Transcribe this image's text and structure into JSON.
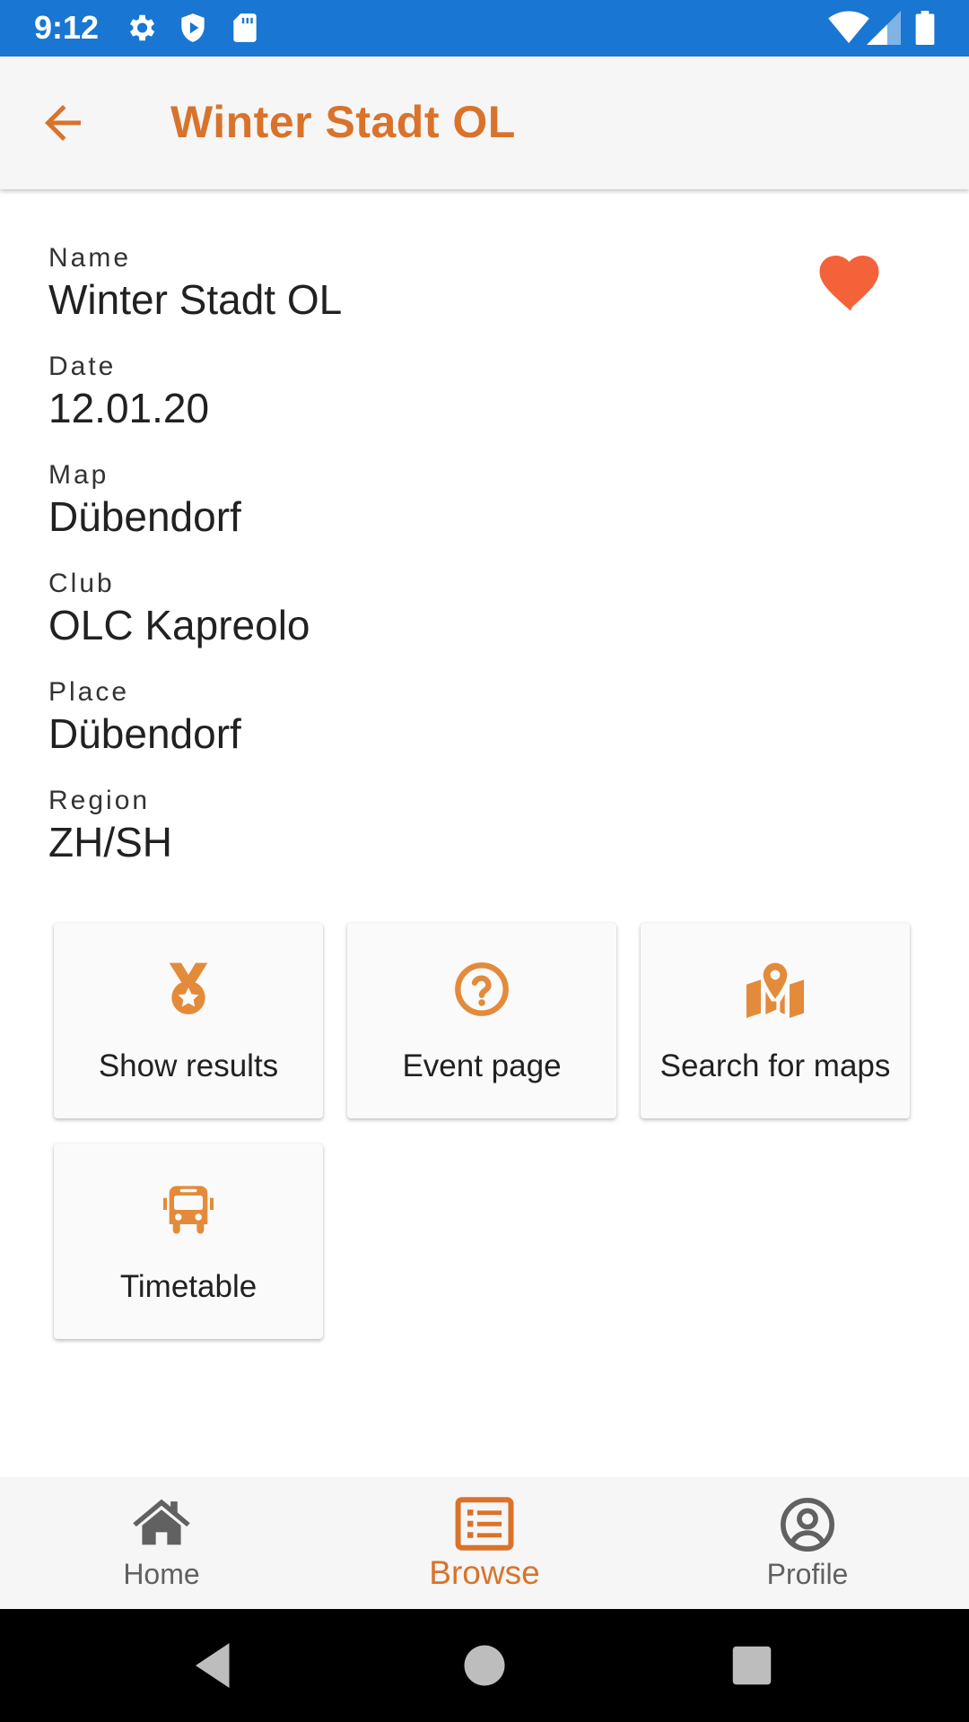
{
  "status_bar": {
    "time": "9:12",
    "icons": [
      "gear-icon",
      "shield-play-icon",
      "sd-card-icon",
      "wifi-icon",
      "cellular-signal-icon",
      "battery-icon"
    ]
  },
  "app_bar": {
    "title": "Winter Stadt OL",
    "back_icon": "arrow-left-icon"
  },
  "details": {
    "fields": [
      {
        "label": "Name",
        "value": "Winter Stadt OL"
      },
      {
        "label": "Date",
        "value": "12.01.20"
      },
      {
        "label": "Map",
        "value": "Dübendorf"
      },
      {
        "label": "Club",
        "value": "OLC Kapreolo"
      },
      {
        "label": "Place",
        "value": "Dübendorf"
      },
      {
        "label": "Region",
        "value": "ZH/SH"
      }
    ],
    "favorite_icon": "heart-icon"
  },
  "actions": [
    {
      "label": "Show results",
      "icon": "medal-icon"
    },
    {
      "label": "Event page",
      "icon": "question-circle-icon"
    },
    {
      "label": "Search for maps",
      "icon": "map-marker-icon"
    },
    {
      "label": "Timetable",
      "icon": "bus-icon"
    }
  ],
  "bottom_nav": {
    "items": [
      {
        "label": "Home",
        "icon": "home-icon"
      },
      {
        "label": "Browse",
        "icon": "list-icon"
      },
      {
        "label": "Profile",
        "icon": "user-circle-icon"
      }
    ],
    "active": "Browse"
  },
  "system_nav": [
    "back-triangle-icon",
    "home-circle-icon",
    "recents-square-icon"
  ],
  "colors": {
    "status_bar": "#1976d2",
    "accent": "#d9732b",
    "icon_orange": "#e38b3a",
    "favorite": "#f4623a",
    "nav_inactive": "#616161"
  }
}
